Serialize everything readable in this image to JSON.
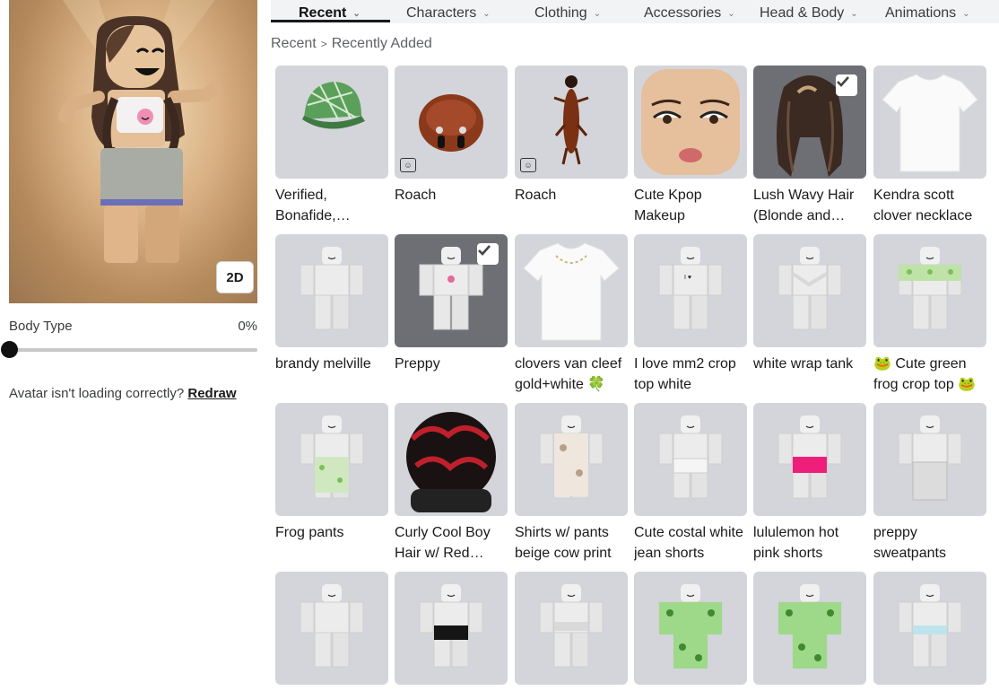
{
  "tabs": [
    {
      "label": "Recent"
    },
    {
      "label": "Characters"
    },
    {
      "label": "Clothing"
    },
    {
      "label": "Accessories"
    },
    {
      "label": "Head & Body"
    },
    {
      "label": "Animations"
    }
  ],
  "breadcrumb": {
    "root": "Recent",
    "current": "Recently Added"
  },
  "avatar": {
    "view_toggle": "2D"
  },
  "body_type": {
    "label": "Body Type",
    "value": "0%",
    "level": 0
  },
  "redraw": {
    "prompt": "Avatar isn't loading correctly?",
    "link": "Redraw"
  },
  "items": [
    {
      "name": "Verified, Bonafide, Plaidafied Green",
      "kind": "plaid-cap",
      "selected": false,
      "bundle": false
    },
    {
      "name": "Roach",
      "kind": "roach-head",
      "selected": false,
      "bundle": true
    },
    {
      "name": "Roach",
      "kind": "roach-body",
      "selected": false,
      "bundle": true
    },
    {
      "name": "Cute Kpop Makeup",
      "kind": "face-makeup",
      "selected": false,
      "bundle": false
    },
    {
      "name": "Lush Wavy Hair (Blonde and Brown)",
      "kind": "wavy-hair",
      "selected": true,
      "bundle": false
    },
    {
      "name": "Kendra scott clover necklace",
      "kind": "white-tee",
      "selected": false,
      "bundle": false
    },
    {
      "name": "brandy melville",
      "kind": "mannequin",
      "selected": false,
      "bundle": false
    },
    {
      "name": "Preppy",
      "kind": "mannequin-pink",
      "selected": true,
      "bundle": false
    },
    {
      "name": "clovers van cleef gold+white 🍀",
      "kind": "white-tee-necklace",
      "selected": false,
      "bundle": false
    },
    {
      "name": "I love mm2 crop top white",
      "kind": "mannequin-mm2",
      "selected": false,
      "bundle": false
    },
    {
      "name": "white wrap tank",
      "kind": "mannequin-wrap",
      "selected": false,
      "bundle": false
    },
    {
      "name": "🐸 Cute green frog crop top 🐸",
      "kind": "mannequin-frog-top",
      "selected": false,
      "bundle": false
    },
    {
      "name": "Frog pants",
      "kind": "mannequin-frog-pants",
      "selected": false,
      "bundle": false
    },
    {
      "name": "Curly Cool Boy Hair w/ Red Highlights",
      "kind": "curly-hair",
      "selected": false,
      "bundle": false
    },
    {
      "name": "Shirts w/ pants beige cow print",
      "kind": "mannequin-cow",
      "selected": false,
      "bundle": false
    },
    {
      "name": "Cute costal white jean shorts",
      "kind": "mannequin-jean",
      "selected": false,
      "bundle": false
    },
    {
      "name": "lululemon hot pink shorts",
      "kind": "mannequin-pink-shorts",
      "selected": false,
      "bundle": false
    },
    {
      "name": "preppy sweatpants",
      "kind": "mannequin-sweat",
      "selected": false,
      "bundle": false
    },
    {
      "name": "",
      "kind": "mannequin",
      "selected": false,
      "bundle": false
    },
    {
      "name": "",
      "kind": "mannequin-black",
      "selected": false,
      "bundle": false
    },
    {
      "name": "",
      "kind": "mannequin-light",
      "selected": false,
      "bundle": false
    },
    {
      "name": "",
      "kind": "mannequin-frog-full",
      "selected": false,
      "bundle": false
    },
    {
      "name": "",
      "kind": "mannequin-frog-full",
      "selected": false,
      "bundle": false
    },
    {
      "name": "",
      "kind": "mannequin-blue",
      "selected": false,
      "bundle": false
    }
  ],
  "colors": {
    "card_bg": "#d4d5db",
    "card_selected_bg": "#6e6f74",
    "text": "#1a1a1a",
    "muted": "#606266"
  }
}
